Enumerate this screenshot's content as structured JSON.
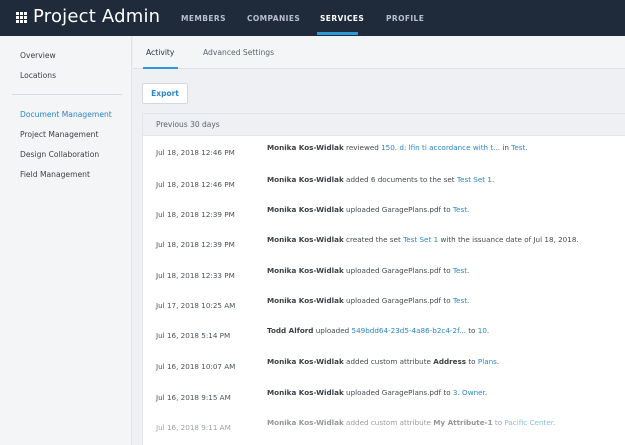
{
  "app": {
    "title": "Project Admin"
  },
  "nav": {
    "members": "MEMBERS",
    "companies": "COMPANIES",
    "services": "SERVICES",
    "profile": "PROFILE"
  },
  "sidebar": {
    "overview": "Overview",
    "locations": "Locations",
    "document_management": "Document Management",
    "project_management": "Project Management",
    "design_collaboration": "Design Collaboration",
    "field_management": "Field Management"
  },
  "tabs": {
    "activity": "Activity",
    "advanced": "Advanced Settings"
  },
  "export_label": "Export",
  "panel": {
    "header": "Previous 30 days"
  },
  "rows": [
    {
      "date": "Jul 18, 2018 12:46 PM",
      "user": "Monika Kos-Widlak",
      "a": " reviewed ",
      "l1": "150. d: lfin ti accordance with t...",
      "b": "  in ",
      "l2": "Test",
      "c": "."
    },
    {
      "date": "Jul 18, 2018 12:46 PM",
      "user": "Monika Kos-Widlak",
      "a": " added 6 documents to the set ",
      "l1": "Test Set 1",
      "b": ".",
      "l2": "",
      "c": ""
    },
    {
      "date": "Jul 18, 2018 12:39 PM",
      "user": "Monika Kos-Widlak",
      "a": " uploaded GaragePlans.pdf to ",
      "l1": "Test",
      "b": ".",
      "l2": "",
      "c": ""
    },
    {
      "date": "Jul 18, 2018 12:39 PM",
      "user": "Monika Kos-Widlak",
      "a": " created the set ",
      "l1": "Test Set 1",
      "b": " with the issuance date of Jul 18, 2018.",
      "l2": "",
      "c": ""
    },
    {
      "date": "Jul 18, 2018 12:33 PM",
      "user": "Monika Kos-Widlak",
      "a": " uploaded GaragePlans.pdf to ",
      "l1": "Test",
      "b": ".",
      "l2": "",
      "c": ""
    },
    {
      "date": "Jul 17, 2018 10:25 AM",
      "user": "Monika Kos-Widlak",
      "a": " uploaded GaragePlans.pdf to ",
      "l1": "Test",
      "b": ".",
      "l2": "",
      "c": ""
    },
    {
      "date": "Jul 16, 2018 5:14 PM",
      "user": "Todd Alford",
      "a": " uploaded ",
      "l1": "549bdd64-23d5-4a86-b2c4-2f...",
      "b": "   to ",
      "l2": "10",
      "c": "."
    },
    {
      "date": "Jul 16, 2018 10:07 AM",
      "user": "Monika Kos-Widlak",
      "a": " added custom attribute ",
      "l1": "",
      "b": "",
      "l2": "Plans",
      "c": "."
    },
    {
      "date": "Jul 16, 2018 9:15 AM",
      "user": "Monika Kos-Widlak",
      "a": " uploaded GaragePlans.pdf to ",
      "l1": "3. Owner",
      "b": ".",
      "l2": "",
      "c": ""
    },
    {
      "date": "Jul 16, 2018 9:11 AM",
      "user": "Monika Kos-Widlak",
      "a": " added custom attribute ",
      "l1": "",
      "b": "",
      "l2": "Pacific Center",
      "c": "."
    }
  ],
  "row_attrs": [
    {
      "index": 7,
      "attr_name": "Address",
      "joiner": " to "
    },
    {
      "index": 9,
      "attr_name": "My Attribute-1",
      "joiner": " to "
    }
  ],
  "colors": {
    "topbar": "#1f2a3b",
    "accent": "#2c9ad8",
    "link": "#2b86c6"
  },
  "icons": {
    "apps": "grid-icon"
  }
}
